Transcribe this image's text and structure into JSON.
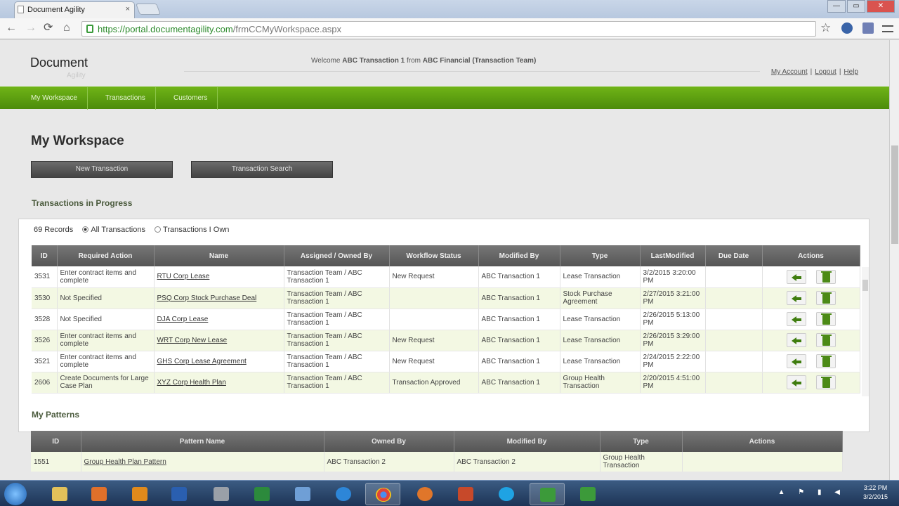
{
  "browser": {
    "tab_title": "Document Agility",
    "tab_close": "×",
    "url_host": "https://portal.documentagility.com",
    "url_path": "/frmCCMyWorkspace.aspx",
    "back": "←",
    "forward": "→",
    "reload": "⟳",
    "home": "⌂",
    "star": "☆",
    "win_min": "—",
    "win_max": "▭",
    "win_close": "✕"
  },
  "header": {
    "logo": "Document",
    "logo_sub": "Agility",
    "welcome_pre": "Welcome ",
    "user": "ABC Transaction 1",
    "welcome_mid": " from ",
    "org": "ABC Financial (Transaction Team)",
    "links": [
      "My Account",
      "Logout",
      "Help"
    ],
    "sep": "|"
  },
  "menu": [
    "My Workspace",
    "Transactions",
    "Customers"
  ],
  "page": {
    "title": "My Workspace",
    "btn_new": "New Transaction",
    "btn_search": "Transaction Search",
    "section_tx": "Transactions in Progress",
    "section_patterns": "My Patterns"
  },
  "transactions": {
    "records": "69 Records",
    "filter_all": "All Transactions",
    "filter_own": "Transactions I Own",
    "columns": [
      "ID",
      "Required Action",
      "Name",
      "Assigned / Owned By",
      "Workflow Status",
      "Modified By",
      "Type",
      "LastModified",
      "Due Date",
      "Actions"
    ],
    "rows": [
      [
        "3531",
        "Enter contract items and complete",
        "RTU Corp Lease",
        "Transaction Team / ABC Transaction 1",
        "New Request",
        "ABC Transaction 1",
        "Lease Transaction",
        "3/2/2015 3:20:00 PM",
        ""
      ],
      [
        "3530",
        "Not Specified",
        "PSQ Corp Stock Purchase Deal",
        "Transaction Team / ABC Transaction 1",
        "",
        "ABC Transaction 1",
        "Stock Purchase Agreement",
        "2/27/2015 3:21:00 PM",
        ""
      ],
      [
        "3528",
        "Not Specified",
        "DJA Corp Lease",
        "Transaction Team / ABC Transaction 1",
        "",
        "ABC Transaction 1",
        "Lease Transaction",
        "2/26/2015 5:13:00 PM",
        ""
      ],
      [
        "3526",
        "Enter contract items and complete",
        "WRT Corp New Lease",
        "Transaction Team / ABC Transaction 1",
        "New Request",
        "ABC Transaction 1",
        "Lease Transaction",
        "2/26/2015 3:29:00 PM",
        ""
      ],
      [
        "3521",
        "Enter contract items and complete",
        "GHS Corp Lease Agreement",
        "Transaction Team / ABC Transaction 1",
        "New Request",
        "ABC Transaction 1",
        "Lease Transaction",
        "2/24/2015 2:22:00 PM",
        ""
      ],
      [
        "2606",
        "Create Documents for Large Case Plan",
        "XYZ Corp Health Plan",
        "Transaction Team / ABC Transaction 1",
        "Transaction Approved",
        "ABC Transaction 1",
        "Group Health Transaction",
        "2/20/2015 4:51:00 PM",
        ""
      ]
    ]
  },
  "patterns": {
    "columns": [
      "ID",
      "Pattern Name",
      "Owned By",
      "Modified By",
      "Type",
      "Actions"
    ],
    "rows": [
      [
        "1551",
        "Group Health Plan Pattern",
        "ABC Transaction 2",
        "ABC Transaction 2",
        "Group Health Transaction",
        ""
      ]
    ]
  },
  "taskbar": {
    "time": "3:22 PM",
    "date": "3/2/2015",
    "tray": "▲ ⚑ ▮ ◀"
  },
  "colors": {
    "menu_green": "#5ea012",
    "row_alt": "#f3f8e3",
    "header_gray": "#666666"
  }
}
